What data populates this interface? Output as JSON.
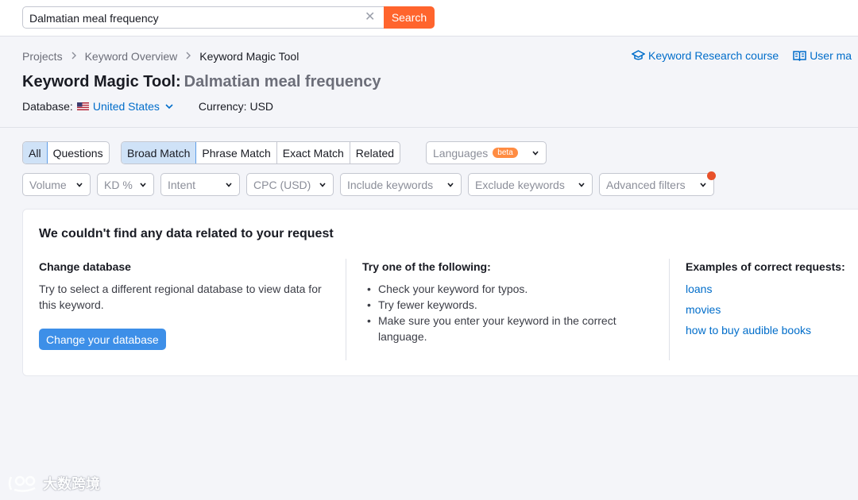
{
  "search": {
    "value": "Dalmatian meal frequency",
    "button_label": "Search"
  },
  "breadcrumb": [
    "Projects",
    "Keyword Overview",
    "Keyword Magic Tool"
  ],
  "help_links": {
    "course": "Keyword Research course",
    "manual": "User ma"
  },
  "title": {
    "tool": "Keyword Magic Tool:",
    "keyword": "Dalmatian meal frequency"
  },
  "database": {
    "label": "Database:",
    "value": "United States",
    "currency": "Currency: USD"
  },
  "filters": {
    "question_tabs": [
      "All",
      "Questions"
    ],
    "match_tabs": [
      "Broad Match",
      "Phrase Match",
      "Exact Match",
      "Related"
    ],
    "languages": "Languages",
    "languages_badge": "beta",
    "dropdowns": [
      "Volume",
      "KD %",
      "Intent",
      "CPC (USD)",
      "Include keywords",
      "Exclude keywords",
      "Advanced filters"
    ]
  },
  "empty_state": {
    "title": "We couldn't find any data related to your request",
    "change_db": {
      "heading": "Change database",
      "text": "Try to select a different regional database to view data for this keyword.",
      "button": "Change your database"
    },
    "suggestions": {
      "heading": "Try one of the following:",
      "items": [
        "Check your keyword for typos.",
        "Try fewer keywords.",
        "Make sure you enter your keyword in the correct language."
      ]
    },
    "examples": {
      "heading": "Examples of correct requests:",
      "items": [
        "loans",
        "movies",
        "how to buy audible books"
      ]
    }
  },
  "watermark": "大数跨境",
  "colors": {
    "search_button": "#ff642d",
    "link": "#006dca",
    "primary_button": "#3d8fe8",
    "active_tab": "#cfe2f7",
    "notification_dot": "#e8512a"
  }
}
